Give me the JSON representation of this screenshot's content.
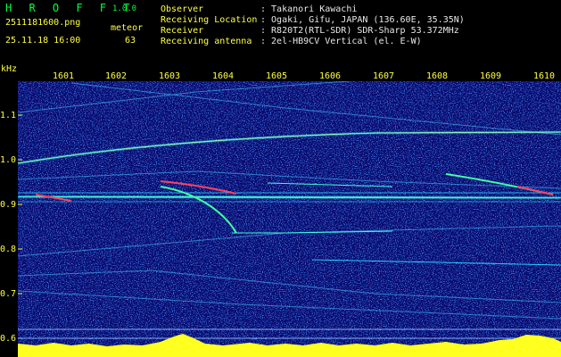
{
  "app": {
    "name": "H R O F F T",
    "version": "1.0.0"
  },
  "capture": {
    "file": "2511181600.png",
    "datetime": "25.11.18 16:00",
    "mode": "meteor",
    "count": "63"
  },
  "observer_info": {
    "labels": [
      "Observer",
      "Receiving Location",
      "Receiver",
      "Receiving antenna"
    ],
    "values": [
      ": Takanori Kawachi",
      ": Ogaki, Gifu, JAPAN (136.60E, 35.35N)",
      ": R820T2(RTL-SDR) SDR-Sharp 53.372MHz",
      ": 2el-HB9CV Vertical (el. E-W)"
    ]
  },
  "axis": {
    "y_unit": "kHz",
    "y_ticks": [
      "1.1",
      "1.0",
      "0.9",
      "0.8",
      "0.7",
      "0.6"
    ],
    "x_ticks": [
      "1601",
      "1602",
      "1603",
      "1604",
      "1605",
      "1606",
      "1607",
      "1608",
      "1609",
      "1610"
    ]
  },
  "colors": {
    "background": "#000000",
    "spectrogram_bg": "#0a0a6e",
    "label_yellow": "#ffff40",
    "title_green": "#00ff40",
    "signal_cyan": "#40ffe0"
  }
}
